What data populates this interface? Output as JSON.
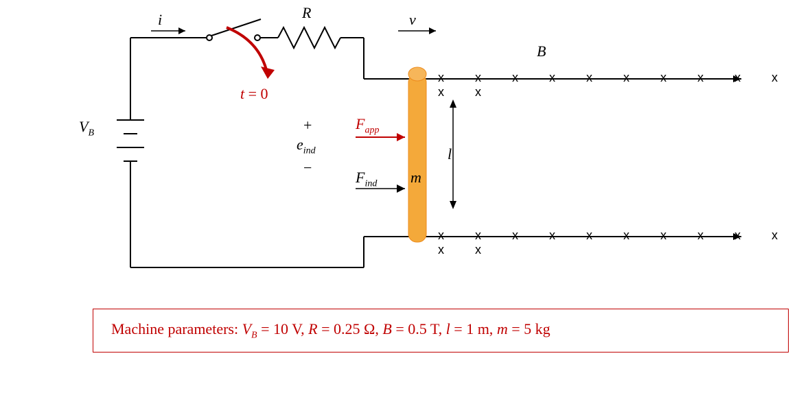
{
  "labels": {
    "VB": "V",
    "VB_sub": "B",
    "i": "i",
    "R": "R",
    "v": "v",
    "B": "B",
    "t0_lhs": "t",
    "t0_rhs": "0",
    "eq": " = ",
    "plus": "+",
    "minus": "−",
    "eind": "e",
    "eind_sub": "ind",
    "Fapp": "F",
    "Fapp_sub": "app",
    "Find": "F",
    "Find_sub": "ind",
    "m": "m",
    "l": "l"
  },
  "field_marks": "x  x  x  x  x  x  x  x  x  x  x  x",
  "params": {
    "prefix": "Machine parameters: ",
    "VB": "V",
    "VB_sub": "B",
    "VB_val": " = 10 V, ",
    "R": "R",
    "R_val": " = 0.25 Ω, ",
    "B": "B",
    "B_val": " = 0.5 T, ",
    "l": "l",
    "l_val": " = 1 m, ",
    "m": "m",
    "m_val": " = 5 kg"
  },
  "chart_data": {
    "type": "diagram",
    "description": "Linear DC machine: battery VB drives current i through switch (closed at t=0) and resistor R into a conducting bar of mass m and length l sliding on rails in uniform magnetic field B (into page, shown by x marks). Induced emf e_ind across bar; induced force F_ind to the right; applied force F_app to the right; bar velocity v to the right.",
    "parameters": {
      "VB_volts": 10,
      "R_ohms": 0.25,
      "B_tesla": 0.5,
      "l_meters": 1,
      "m_kg": 5
    },
    "switch_closes_at_t": 0,
    "magnetic_field_direction": "into page",
    "bar_velocity_direction": "right",
    "F_ind_direction": "right",
    "F_app_direction": "right",
    "current_direction": "clockwise (into top rail, down through bar)"
  }
}
